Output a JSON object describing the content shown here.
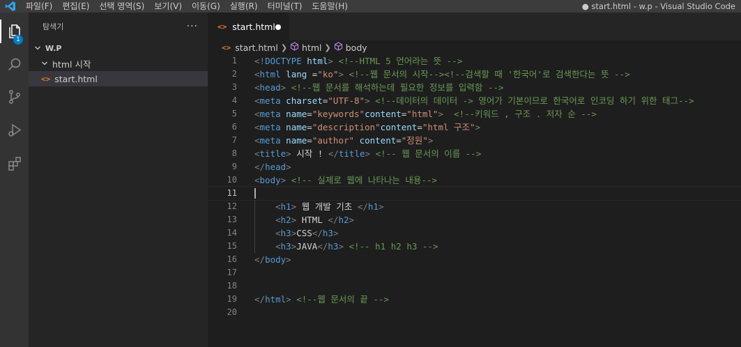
{
  "menu": [
    "파일(F)",
    "편집(E)",
    "선택 영역(S)",
    "보기(V)",
    "이동(G)",
    "실행(R)",
    "터미널(T)",
    "도움말(H)"
  ],
  "window_title": "● start.html - w.p - Visual Studio Code",
  "activity": {
    "explorer_badge": "1"
  },
  "explorer": {
    "title": "탐색기",
    "more": "···",
    "root_folder": "W.P",
    "subfolder": "html 시작",
    "file": "start.html"
  },
  "tab": {
    "label": "start.html",
    "dirty": true
  },
  "breadcrumb": {
    "file": "start.html",
    "html": "html",
    "body": "body"
  },
  "line_numbers": [
    "1",
    "2",
    "3",
    "4",
    "5",
    "6",
    "7",
    "8",
    "9",
    "10",
    "11",
    "12",
    "13",
    "14",
    "15",
    "16",
    "17",
    "18",
    "19",
    "20"
  ],
  "current_line": 11,
  "code_lines": [
    [
      [
        "p",
        "<!"
      ],
      [
        "t",
        "DOCTYPE"
      ],
      [
        "x",
        " "
      ],
      [
        "a",
        "html"
      ],
      [
        "p",
        ">"
      ],
      [
        "x",
        " "
      ],
      [
        "c",
        "<!--HTML 5 언어라는 뜻 -->"
      ]
    ],
    [
      [
        "p",
        "<"
      ],
      [
        "t",
        "html"
      ],
      [
        "x",
        " "
      ],
      [
        "a",
        "lang"
      ],
      [
        "x",
        " ="
      ],
      [
        "s",
        "\"ko\""
      ],
      [
        "p",
        ">"
      ],
      [
        "x",
        " "
      ],
      [
        "c",
        "<!--웹 문서의 시작--><!--검색할 때 '한국어'로 검색한다는 뜻 -->"
      ]
    ],
    [
      [
        "p",
        "<"
      ],
      [
        "t",
        "head"
      ],
      [
        "p",
        ">"
      ],
      [
        "x",
        " "
      ],
      [
        "c",
        "<!--웹 문서를 해석하는데 필요한 정보를 입력함 -->"
      ]
    ],
    [
      [
        "p",
        "<"
      ],
      [
        "t",
        "meta"
      ],
      [
        "x",
        " "
      ],
      [
        "a",
        "charset"
      ],
      [
        "x",
        "="
      ],
      [
        "s",
        "\"UTF-8\""
      ],
      [
        "p",
        ">"
      ],
      [
        "x",
        " "
      ],
      [
        "c",
        "<!--데이터의 데이터 -> 영어가 기본이므로 한국어로 인코딩 하기 위한 태그-->"
      ]
    ],
    [
      [
        "p",
        "<"
      ],
      [
        "t",
        "meta"
      ],
      [
        "x",
        " "
      ],
      [
        "a",
        "name"
      ],
      [
        "x",
        "="
      ],
      [
        "s",
        "\"keywords\""
      ],
      [
        "a",
        "content"
      ],
      [
        "x",
        "="
      ],
      [
        "s",
        "\"html\""
      ],
      [
        "p",
        ">"
      ],
      [
        "x",
        "  "
      ],
      [
        "c",
        "<!--키워드 , 구조 . 저자 순 -->"
      ]
    ],
    [
      [
        "p",
        "<"
      ],
      [
        "t",
        "meta"
      ],
      [
        "x",
        " "
      ],
      [
        "a",
        "name"
      ],
      [
        "x",
        "="
      ],
      [
        "s",
        "\"description\""
      ],
      [
        "a",
        "content"
      ],
      [
        "x",
        "="
      ],
      [
        "s",
        "\"html 구조\""
      ],
      [
        "p",
        ">"
      ]
    ],
    [
      [
        "p",
        "<"
      ],
      [
        "t",
        "meta"
      ],
      [
        "x",
        " "
      ],
      [
        "a",
        "name"
      ],
      [
        "x",
        "="
      ],
      [
        "s",
        "\"author\""
      ],
      [
        "x",
        " "
      ],
      [
        "a",
        "content"
      ],
      [
        "x",
        "="
      ],
      [
        "s",
        "\"정원\""
      ],
      [
        "p",
        ">"
      ]
    ],
    [
      [
        "p",
        "<"
      ],
      [
        "t",
        "title"
      ],
      [
        "p",
        ">"
      ],
      [
        "x",
        " 시작 ! "
      ],
      [
        "p",
        "</"
      ],
      [
        "t",
        "title"
      ],
      [
        "p",
        ">"
      ],
      [
        "x",
        " "
      ],
      [
        "c",
        "<!-- 웹 문서의 이름 -->"
      ]
    ],
    [
      [
        "p",
        "</"
      ],
      [
        "t",
        "head"
      ],
      [
        "p",
        ">"
      ]
    ],
    [
      [
        "p",
        "<"
      ],
      [
        "t",
        "body"
      ],
      [
        "p",
        ">"
      ],
      [
        "x",
        " "
      ],
      [
        "c",
        "<!-- 실제로 웹에 나타나는 내용-->"
      ]
    ],
    [],
    [
      [
        "x",
        "    "
      ],
      [
        "p",
        "<"
      ],
      [
        "t",
        "h1"
      ],
      [
        "p",
        ">"
      ],
      [
        "x",
        " 웹 개발 기초 "
      ],
      [
        "p",
        "</"
      ],
      [
        "t",
        "h1"
      ],
      [
        "p",
        ">"
      ]
    ],
    [
      [
        "x",
        "    "
      ],
      [
        "p",
        "<"
      ],
      [
        "t",
        "h2"
      ],
      [
        "p",
        ">"
      ],
      [
        "x",
        " HTML "
      ],
      [
        "p",
        "</"
      ],
      [
        "t",
        "h2"
      ],
      [
        "p",
        ">"
      ]
    ],
    [
      [
        "x",
        "    "
      ],
      [
        "p",
        "<"
      ],
      [
        "t",
        "h3"
      ],
      [
        "p",
        ">"
      ],
      [
        "x",
        "CSS"
      ],
      [
        "p",
        "</"
      ],
      [
        "t",
        "h3"
      ],
      [
        "p",
        ">"
      ]
    ],
    [
      [
        "x",
        "    "
      ],
      [
        "p",
        "<"
      ],
      [
        "t",
        "h3"
      ],
      [
        "p",
        ">"
      ],
      [
        "x",
        "JAVA"
      ],
      [
        "p",
        "</"
      ],
      [
        "t",
        "h3"
      ],
      [
        "p",
        ">"
      ],
      [
        "x",
        " "
      ],
      [
        "c",
        "<!-- h1 h2 h3 -->"
      ]
    ],
    [
      [
        "p",
        "</"
      ],
      [
        "t",
        "body"
      ],
      [
        "p",
        ">"
      ]
    ],
    [],
    [],
    [
      [
        "p",
        "</"
      ],
      [
        "t",
        "html"
      ],
      [
        "p",
        ">"
      ],
      [
        "x",
        " "
      ],
      [
        "c",
        "<!--웹 문서의 끝 -->"
      ]
    ],
    []
  ],
  "colors": {
    "tag": "#569cd6",
    "punct": "#808080",
    "attr": "#9cdcfe",
    "string": "#ce9178",
    "comment": "#6a9955",
    "text": "#d4d4d4",
    "accent": "#007acc",
    "file_icon": "#e37933"
  }
}
